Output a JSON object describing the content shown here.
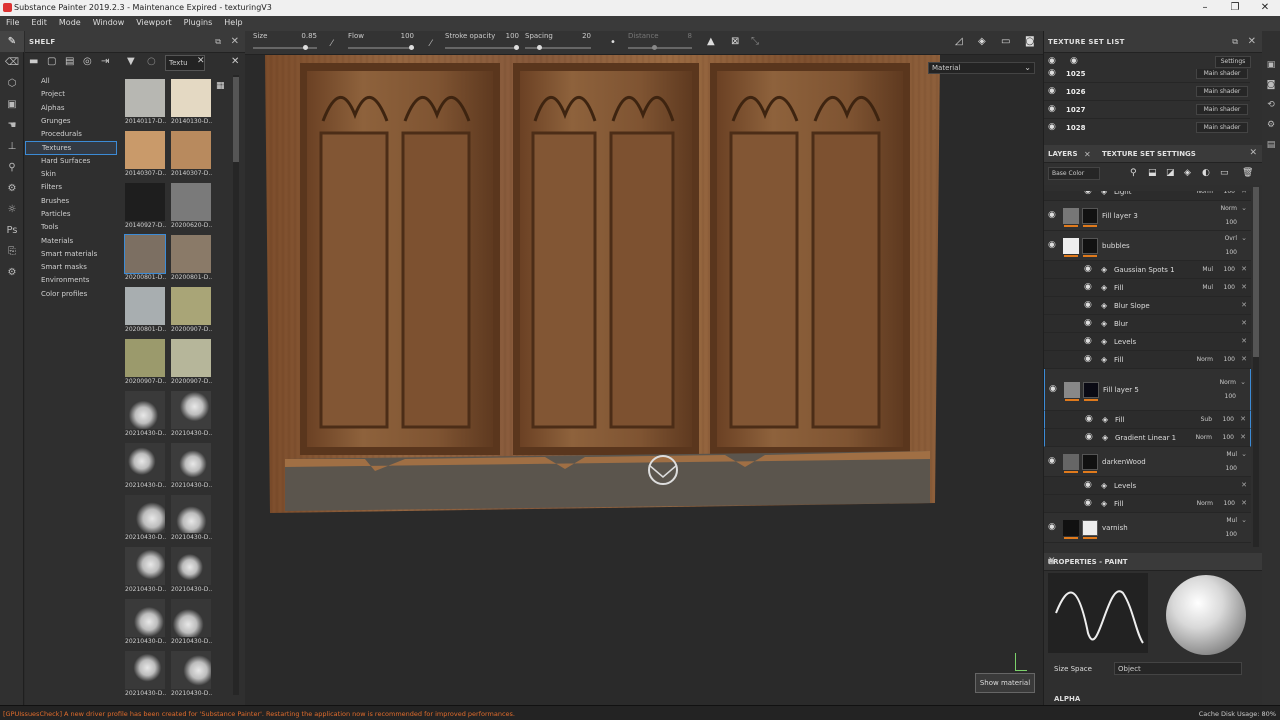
{
  "window": {
    "title": "Substance Painter 2019.2.3 - Maintenance Expired - texturingV3"
  },
  "menu": [
    "File",
    "Edit",
    "Mode",
    "Window",
    "Viewport",
    "Plugins",
    "Help"
  ],
  "toolbar": {
    "size": {
      "label": "Size",
      "value": "0.85",
      "fill": 0.85
    },
    "flow": {
      "label": "Flow",
      "value": "100",
      "fill": 1.0
    },
    "stroke_opacity": {
      "label": "Stroke opacity",
      "value": "100",
      "fill": 1.0
    },
    "spacing": {
      "label": "Spacing",
      "value": "20",
      "fill": 0.2
    },
    "distance": {
      "label": "Distance",
      "value": "8",
      "fill": 0.4
    }
  },
  "shelf": {
    "title": "SHELF",
    "filter_tab": "Textu",
    "categories": [
      "All",
      "Project",
      "Alphas",
      "Grunges",
      "Procedurals",
      "Textures",
      "Hard Surfaces",
      "Skin",
      "Filters",
      "Brushes",
      "Particles",
      "Tools",
      "Materials",
      "Smart materials",
      "Smart masks",
      "Environments",
      "Color profiles"
    ],
    "selected_category": "Textures",
    "thumbnails": [
      {
        "label": "20140117-D...",
        "color": "#b7b7b2"
      },
      {
        "label": "20140130-D...",
        "color": "#e4d9c3"
      },
      {
        "label": "20140307-D...",
        "color": "#c99a6a"
      },
      {
        "label": "20140307-D...",
        "color": "#b88a5e"
      },
      {
        "label": "20140927-D...",
        "color": "#1e1e1e"
      },
      {
        "label": "20200620-D...",
        "color": "#7a7a7a"
      },
      {
        "label": "20200801-D...",
        "color": "#7c6f62"
      },
      {
        "label": "20200801-D...",
        "color": "#8a7a68"
      },
      {
        "label": "20200801-D...",
        "color": "#a8aeb0"
      },
      {
        "label": "20200907-D...",
        "color": "#a9a577"
      },
      {
        "label": "20200907-D...",
        "color": "#9b9a6c"
      },
      {
        "label": "20200907-D...",
        "color": "#b6b69a"
      },
      {
        "label": "20210430-D...",
        "color": "#3a3a3a"
      },
      {
        "label": "20210430-D...",
        "color": "#3d3d3d"
      },
      {
        "label": "20210430-D...",
        "color": "#383838"
      },
      {
        "label": "20210430-D...",
        "color": "#3c3c3c"
      },
      {
        "label": "20210430-D...",
        "color": "#363636"
      },
      {
        "label": "20210430-D...",
        "color": "#393939"
      },
      {
        "label": "20210430-D...",
        "color": "#3b3b3b"
      },
      {
        "label": "20210430-D...",
        "color": "#383838"
      },
      {
        "label": "20210430-D...",
        "color": "#3a3a3a"
      },
      {
        "label": "20210430-D...",
        "color": "#373737"
      },
      {
        "label": "20210430-D...",
        "color": "#393939"
      },
      {
        "label": "20210430-D...",
        "color": "#3a3a3a"
      }
    ]
  },
  "viewport": {
    "material_mode": "Material",
    "show_material_button": "Show material"
  },
  "texture_set_list": {
    "title": "TEXTURE SET LIST",
    "settings": "Settings",
    "rows": [
      {
        "name": "1025",
        "shader": "Main shader"
      },
      {
        "name": "1026",
        "shader": "Main shader"
      },
      {
        "name": "1027",
        "shader": "Main shader"
      },
      {
        "name": "1028",
        "shader": "Main shader"
      }
    ]
  },
  "layers": {
    "tab_layers": "LAYERS",
    "tab_settings": "TEXTURE SET SETTINGS",
    "channel": "Base Color",
    "items": [
      {
        "name": "Light",
        "kind": "sub",
        "blend": "Norm",
        "opacity": "100"
      },
      {
        "name": "Fill layer 3",
        "kind": "layer",
        "blend": "Norm",
        "opacity": "100"
      },
      {
        "name": "bubbles",
        "kind": "layer",
        "blend": "Ovrl",
        "opacity": "100"
      },
      {
        "name": "Gaussian Spots 1",
        "kind": "sub",
        "blend": "Mul",
        "opacity": "100"
      },
      {
        "name": "Fill",
        "kind": "sub",
        "blend": "Mul",
        "opacity": "100"
      },
      {
        "name": "Blur Slope",
        "kind": "sub",
        "blend": "",
        "opacity": ""
      },
      {
        "name": "Blur",
        "kind": "sub",
        "blend": "",
        "opacity": ""
      },
      {
        "name": "Levels",
        "kind": "sub",
        "blend": "",
        "opacity": ""
      },
      {
        "name": "Fill",
        "kind": "sub",
        "blend": "Norm",
        "opacity": "100"
      },
      {
        "name": "Fill layer 5",
        "kind": "layer",
        "blend": "Norm",
        "opacity": "100"
      },
      {
        "name": "Fill",
        "kind": "sub",
        "blend": "Sub",
        "opacity": "100"
      },
      {
        "name": "Gradient Linear 1",
        "kind": "sub",
        "blend": "Norm",
        "opacity": "100"
      },
      {
        "name": "darkenWood",
        "kind": "layer",
        "blend": "Mul",
        "opacity": "100"
      },
      {
        "name": "Levels",
        "kind": "sub",
        "blend": "",
        "opacity": ""
      },
      {
        "name": "Fill",
        "kind": "sub",
        "blend": "Norm",
        "opacity": "100"
      },
      {
        "name": "varnish",
        "kind": "layer",
        "blend": "Mul",
        "opacity": "100"
      }
    ]
  },
  "properties": {
    "title": "PROPERTIES - PAINT",
    "size_space": "Size Space",
    "size_space_value": "Object",
    "alpha": "ALPHA"
  },
  "status": {
    "message": "[GPUIssuesCheck] A new driver profile has been created for 'Substance Painter'. Restarting the application now is recommended for improved performances.",
    "cache": "Cache Disk Usage:   80%"
  },
  "colors": {
    "accent": "#3c8bd6",
    "orange": "#e07a1c",
    "wood": "#8b5a34",
    "panel": "#2f2f2f"
  }
}
